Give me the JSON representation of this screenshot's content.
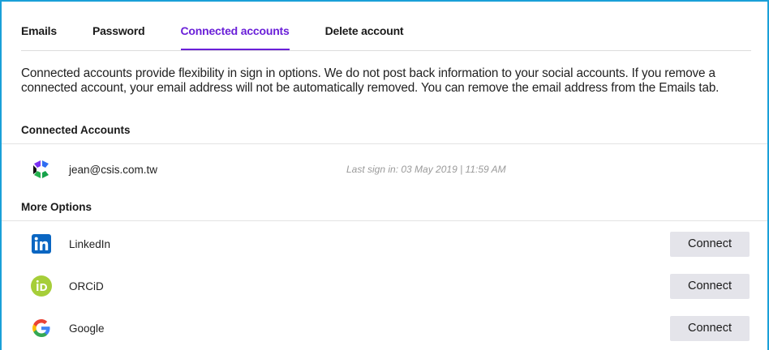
{
  "tabs": [
    {
      "label": "Emails"
    },
    {
      "label": "Password"
    },
    {
      "label": "Connected accounts",
      "active": true
    },
    {
      "label": "Delete account"
    }
  ],
  "description": "Connected accounts provide flexibility in sign in options. We do not post back information to your social accounts. If you remove a connected account, your email address will not be automatically removed. You can remove the email address from the Emails tab.",
  "connected": {
    "heading": "Connected Accounts",
    "accounts": [
      {
        "icon": "provider-logo-icon",
        "email": "jean@csis.com.tw",
        "last_sign_in": "Last sign in: 03 May 2019 | 11:59 AM"
      }
    ]
  },
  "more_options": {
    "heading": "More Options",
    "items": [
      {
        "icon": "linkedin-icon",
        "label": "LinkedIn",
        "button": "Connect"
      },
      {
        "icon": "orcid-icon",
        "label": "ORCiD",
        "button": "Connect"
      },
      {
        "icon": "google-icon",
        "label": "Google",
        "button": "Connect"
      }
    ]
  },
  "colors": {
    "accent": "#6a1fd8",
    "frame": "#1aa0d8",
    "button_bg": "#e4e4ea",
    "linkedin": "#0a66c2",
    "orcid": "#a6ce39"
  }
}
